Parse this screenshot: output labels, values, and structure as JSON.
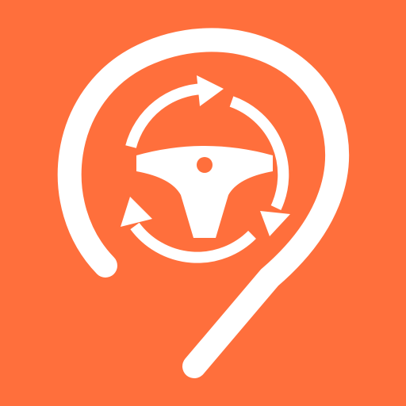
{
  "icon": {
    "name": "app-logo",
    "background_color": "#FF6F3C",
    "foreground_color": "#FFFFFF",
    "elements": [
      "map-pin-outline-icon",
      "refresh-cycle-arrows-icon",
      "steering-wheel-icon"
    ]
  }
}
